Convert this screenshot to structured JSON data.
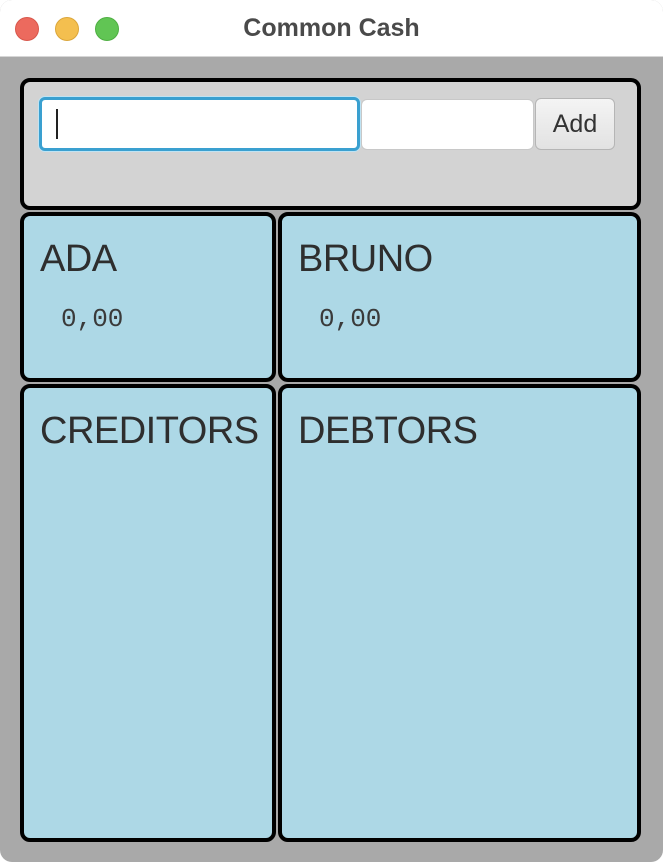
{
  "window": {
    "title": "Common Cash"
  },
  "entry": {
    "name_value": "",
    "amount_value": "",
    "add_label": "Add"
  },
  "people": [
    {
      "name": "ADA",
      "balance": "0,00"
    },
    {
      "name": "BRUNO",
      "balance": "0,00"
    }
  ],
  "lists": {
    "creditors_label": "CREDITORS",
    "debtors_label": "DEBTORS"
  },
  "colors": {
    "panel_blue": "#add8e6",
    "input_panel_gray": "#d3d3d3",
    "window_background": "#a9a9a9",
    "focus_ring": "#3aa0d0",
    "traffic_close": "#ec6a5e",
    "traffic_minimize": "#f4bf4f",
    "traffic_zoom": "#61c554"
  }
}
